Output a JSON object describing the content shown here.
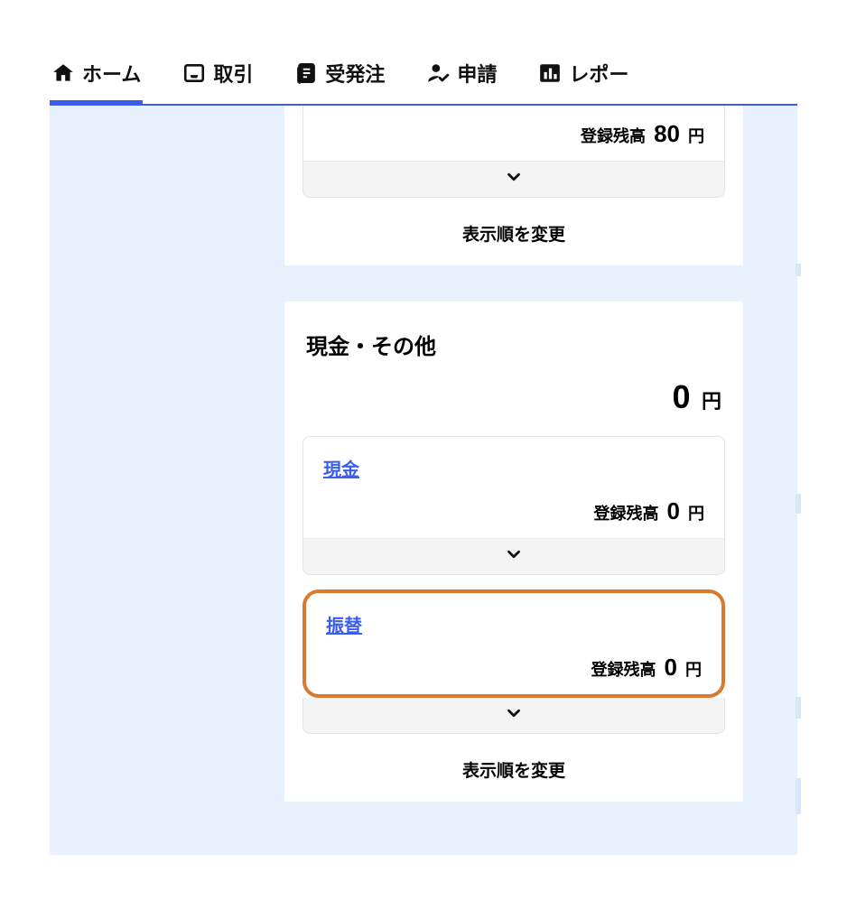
{
  "nav": {
    "tabs": [
      {
        "label": "ホーム"
      },
      {
        "label": "取引"
      },
      {
        "label": "受発注"
      },
      {
        "label": "申請"
      },
      {
        "label": "レポー"
      }
    ]
  },
  "card1": {
    "balance_label": "登録残高",
    "balance_value": "80",
    "yen": "円",
    "reorder": "表示順を変更"
  },
  "card2": {
    "title": "現金・その他",
    "total_value": "0",
    "yen": "円",
    "items": [
      {
        "name": "現金",
        "balance_label": "登録残高",
        "balance_value": "0",
        "yen": "円"
      },
      {
        "name": "振替",
        "balance_label": "登録残高",
        "balance_value": "0",
        "yen": "円"
      }
    ],
    "reorder": "表示順を変更"
  }
}
